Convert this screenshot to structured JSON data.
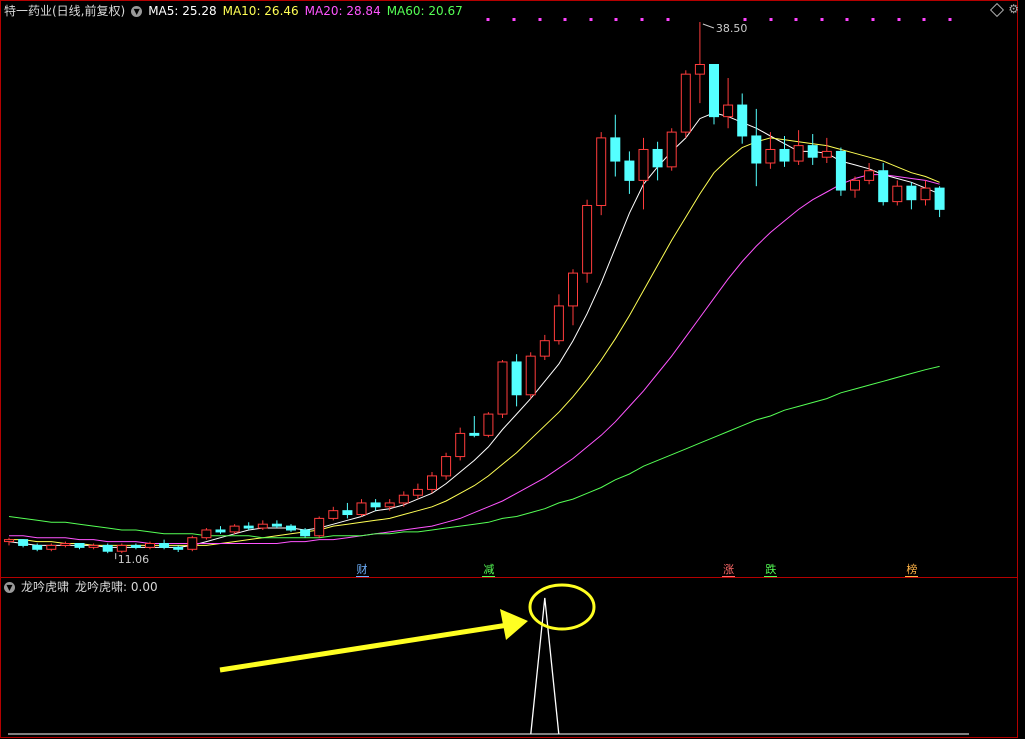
{
  "header": {
    "title": "特一药业(日线,前复权)",
    "toggle_icon": "chevron-down-icon",
    "ma": [
      {
        "label": "MA5: 25.28",
        "color": "#ffffff"
      },
      {
        "label": "MA10: 26.46",
        "color": "#ffff55"
      },
      {
        "label": "MA20: 28.84",
        "color": "#ff55ff"
      },
      {
        "label": "MA60: 20.67",
        "color": "#55ff55"
      }
    ]
  },
  "indicator": {
    "title": "龙吟虎啸",
    "value_label": "龙吟虎啸: 0.00"
  },
  "chart": {
    "price_high_label": "38.50",
    "price_low_label": "11.06",
    "events": [
      {
        "label": "财",
        "color": "#6fb2ff"
      },
      {
        "label": "减",
        "color": "#55ff55"
      },
      {
        "label": "涨",
        "color": "#ff6a6a"
      },
      {
        "label": "跌",
        "color": "#55ff55"
      },
      {
        "label": "榜",
        "color": "#ffb347"
      }
    ]
  },
  "chart_data": {
    "type": "candlestick",
    "candles": [
      [
        11.6,
        11.8,
        11.4,
        11.7
      ],
      [
        11.7,
        11.7,
        11.3,
        11.4
      ],
      [
        11.4,
        11.5,
        11.1,
        11.2
      ],
      [
        11.2,
        11.5,
        11.1,
        11.4
      ],
      [
        11.4,
        11.6,
        11.3,
        11.5
      ],
      [
        11.5,
        11.5,
        11.2,
        11.3
      ],
      [
        11.3,
        11.5,
        11.2,
        11.4
      ],
      [
        11.4,
        11.5,
        11.0,
        11.1
      ],
      [
        11.1,
        11.5,
        11.0,
        11.4
      ],
      [
        11.4,
        11.5,
        11.2,
        11.3
      ],
      [
        11.3,
        11.6,
        11.2,
        11.5
      ],
      [
        11.5,
        11.7,
        11.2,
        11.3
      ],
      [
        11.3,
        11.4,
        11.06,
        11.2
      ],
      [
        11.2,
        11.9,
        11.1,
        11.8
      ],
      [
        11.8,
        12.3,
        11.7,
        12.2
      ],
      [
        12.2,
        12.4,
        12.0,
        12.1
      ],
      [
        12.1,
        12.5,
        12.0,
        12.4
      ],
      [
        12.4,
        12.6,
        12.2,
        12.3
      ],
      [
        12.3,
        12.7,
        12.2,
        12.5
      ],
      [
        12.5,
        12.7,
        12.3,
        12.4
      ],
      [
        12.4,
        12.5,
        12.1,
        12.2
      ],
      [
        12.2,
        12.3,
        11.8,
        11.9
      ],
      [
        11.9,
        12.9,
        11.8,
        12.8
      ],
      [
        12.8,
        13.4,
        12.7,
        13.2
      ],
      [
        13.2,
        13.6,
        12.8,
        13.0
      ],
      [
        13.0,
        13.8,
        12.9,
        13.6
      ],
      [
        13.6,
        13.8,
        13.2,
        13.4
      ],
      [
        13.4,
        13.8,
        13.2,
        13.6
      ],
      [
        13.6,
        14.2,
        13.4,
        14.0
      ],
      [
        14.0,
        14.6,
        13.8,
        14.3
      ],
      [
        14.3,
        15.2,
        14.1,
        15.0
      ],
      [
        15.0,
        16.2,
        14.8,
        16.0
      ],
      [
        16.0,
        17.5,
        15.8,
        17.2
      ],
      [
        17.2,
        18.1,
        17.0,
        17.1
      ],
      [
        17.1,
        18.3,
        17.0,
        18.2
      ],
      [
        18.2,
        21.0,
        18.0,
        20.9
      ],
      [
        20.9,
        21.3,
        18.6,
        19.2
      ],
      [
        19.2,
        21.4,
        19.0,
        21.2
      ],
      [
        21.2,
        22.3,
        21.0,
        22.0
      ],
      [
        22.0,
        24.4,
        21.8,
        23.8
      ],
      [
        23.8,
        25.7,
        22.8,
        25.5
      ],
      [
        25.5,
        29.3,
        25.0,
        29.0
      ],
      [
        29.0,
        32.8,
        28.5,
        32.5
      ],
      [
        32.5,
        33.7,
        30.5,
        31.3
      ],
      [
        31.3,
        31.8,
        29.6,
        30.3
      ],
      [
        30.3,
        32.5,
        28.8,
        31.9
      ],
      [
        31.9,
        32.3,
        30.3,
        31.0
      ],
      [
        31.0,
        33.0,
        30.8,
        32.8
      ],
      [
        32.8,
        36.0,
        32.5,
        35.8
      ],
      [
        35.8,
        38.5,
        34.3,
        36.3
      ],
      [
        36.3,
        35.5,
        33.2,
        33.6
      ],
      [
        33.6,
        35.6,
        33.0,
        34.2
      ],
      [
        34.2,
        34.8,
        32.2,
        32.6
      ],
      [
        32.6,
        34.0,
        30.0,
        31.2
      ],
      [
        31.2,
        32.8,
        30.9,
        31.9
      ],
      [
        31.9,
        32.6,
        31.0,
        31.3
      ],
      [
        31.3,
        32.9,
        31.1,
        32.1
      ],
      [
        32.1,
        32.7,
        31.1,
        31.5
      ],
      [
        31.5,
        32.5,
        31.2,
        31.8
      ],
      [
        31.8,
        32.0,
        29.5,
        29.8
      ],
      [
        29.8,
        30.5,
        29.4,
        30.3
      ],
      [
        30.3,
        31.2,
        30.1,
        30.8
      ],
      [
        30.8,
        31.2,
        29.0,
        29.2
      ],
      [
        29.2,
        30.3,
        29.0,
        30.0
      ],
      [
        30.0,
        30.2,
        28.8,
        29.3
      ],
      [
        29.3,
        30.3,
        29.0,
        29.9
      ],
      [
        29.9,
        30.0,
        28.4,
        28.8
      ]
    ],
    "ma": {
      "MA5": [
        11.6,
        11.5,
        11.4,
        11.4,
        11.4,
        11.4,
        11.4,
        11.3,
        11.3,
        11.3,
        11.3,
        11.3,
        11.3,
        11.4,
        11.6,
        11.8,
        12.0,
        12.2,
        12.3,
        12.3,
        12.3,
        12.2,
        12.3,
        12.5,
        12.7,
        12.9,
        13.2,
        13.3,
        13.5,
        13.8,
        14.1,
        14.6,
        15.2,
        15.8,
        16.5,
        17.4,
        18.2,
        19.0,
        19.9,
        20.8,
        22.0,
        23.4,
        25.0,
        26.8,
        28.6,
        30.1,
        31.0,
        31.8,
        32.5,
        33.5,
        33.8,
        33.6,
        33.3,
        33.0,
        32.6,
        32.2,
        31.8,
        31.8,
        31.7,
        31.3,
        31.1,
        30.9,
        30.6,
        30.4,
        30.2,
        29.9,
        29.6
      ],
      "MA10": [
        11.7,
        11.7,
        11.6,
        11.6,
        11.5,
        11.5,
        11.4,
        11.4,
        11.4,
        11.4,
        11.4,
        11.4,
        11.4,
        11.4,
        11.4,
        11.5,
        11.6,
        11.7,
        11.8,
        11.9,
        12.0,
        12.1,
        12.2,
        12.4,
        12.5,
        12.6,
        12.7,
        12.8,
        13.0,
        13.2,
        13.4,
        13.7,
        14.1,
        14.5,
        15.0,
        15.6,
        16.2,
        16.9,
        17.6,
        18.3,
        19.1,
        20.0,
        21.0,
        22.1,
        23.3,
        24.6,
        25.9,
        27.2,
        28.4,
        29.6,
        30.7,
        31.4,
        32.0,
        32.3,
        32.5,
        32.4,
        32.3,
        32.2,
        32.1,
        31.9,
        31.7,
        31.5,
        31.3,
        31.0,
        30.7,
        30.5,
        30.2
      ],
      "MA20": [
        11.9,
        11.9,
        11.8,
        11.8,
        11.8,
        11.7,
        11.7,
        11.6,
        11.6,
        11.6,
        11.5,
        11.5,
        11.5,
        11.5,
        11.5,
        11.5,
        11.5,
        11.5,
        11.5,
        11.5,
        11.6,
        11.6,
        11.7,
        11.7,
        11.8,
        11.9,
        12.0,
        12.1,
        12.2,
        12.3,
        12.4,
        12.6,
        12.8,
        13.1,
        13.4,
        13.7,
        14.1,
        14.5,
        14.9,
        15.4,
        15.9,
        16.5,
        17.1,
        17.8,
        18.6,
        19.4,
        20.3,
        21.2,
        22.2,
        23.2,
        24.2,
        25.2,
        26.1,
        26.9,
        27.6,
        28.2,
        28.8,
        29.3,
        29.7,
        30.1,
        30.4,
        30.6,
        30.6,
        30.5,
        30.4,
        30.3,
        30.1
      ],
      "MA60": [
        12.9,
        12.8,
        12.7,
        12.6,
        12.6,
        12.5,
        12.4,
        12.3,
        12.2,
        12.2,
        12.1,
        12.0,
        12.0,
        12.0,
        11.9,
        11.9,
        11.9,
        11.9,
        11.8,
        11.8,
        11.8,
        11.8,
        11.8,
        11.9,
        11.9,
        11.9,
        12.0,
        12.0,
        12.1,
        12.1,
        12.2,
        12.3,
        12.4,
        12.5,
        12.6,
        12.8,
        12.9,
        13.1,
        13.3,
        13.6,
        13.8,
        14.1,
        14.4,
        14.8,
        15.1,
        15.5,
        15.8,
        16.1,
        16.4,
        16.7,
        17.0,
        17.3,
        17.6,
        17.9,
        18.1,
        18.4,
        18.6,
        18.8,
        19.0,
        19.3,
        19.5,
        19.7,
        19.9,
        20.1,
        20.3,
        20.5,
        20.67
      ]
    },
    "indicator_values_nonzero": {
      "index": 38,
      "value": 1
    },
    "event_indices": [
      25,
      34,
      51,
      54,
      64
    ]
  }
}
